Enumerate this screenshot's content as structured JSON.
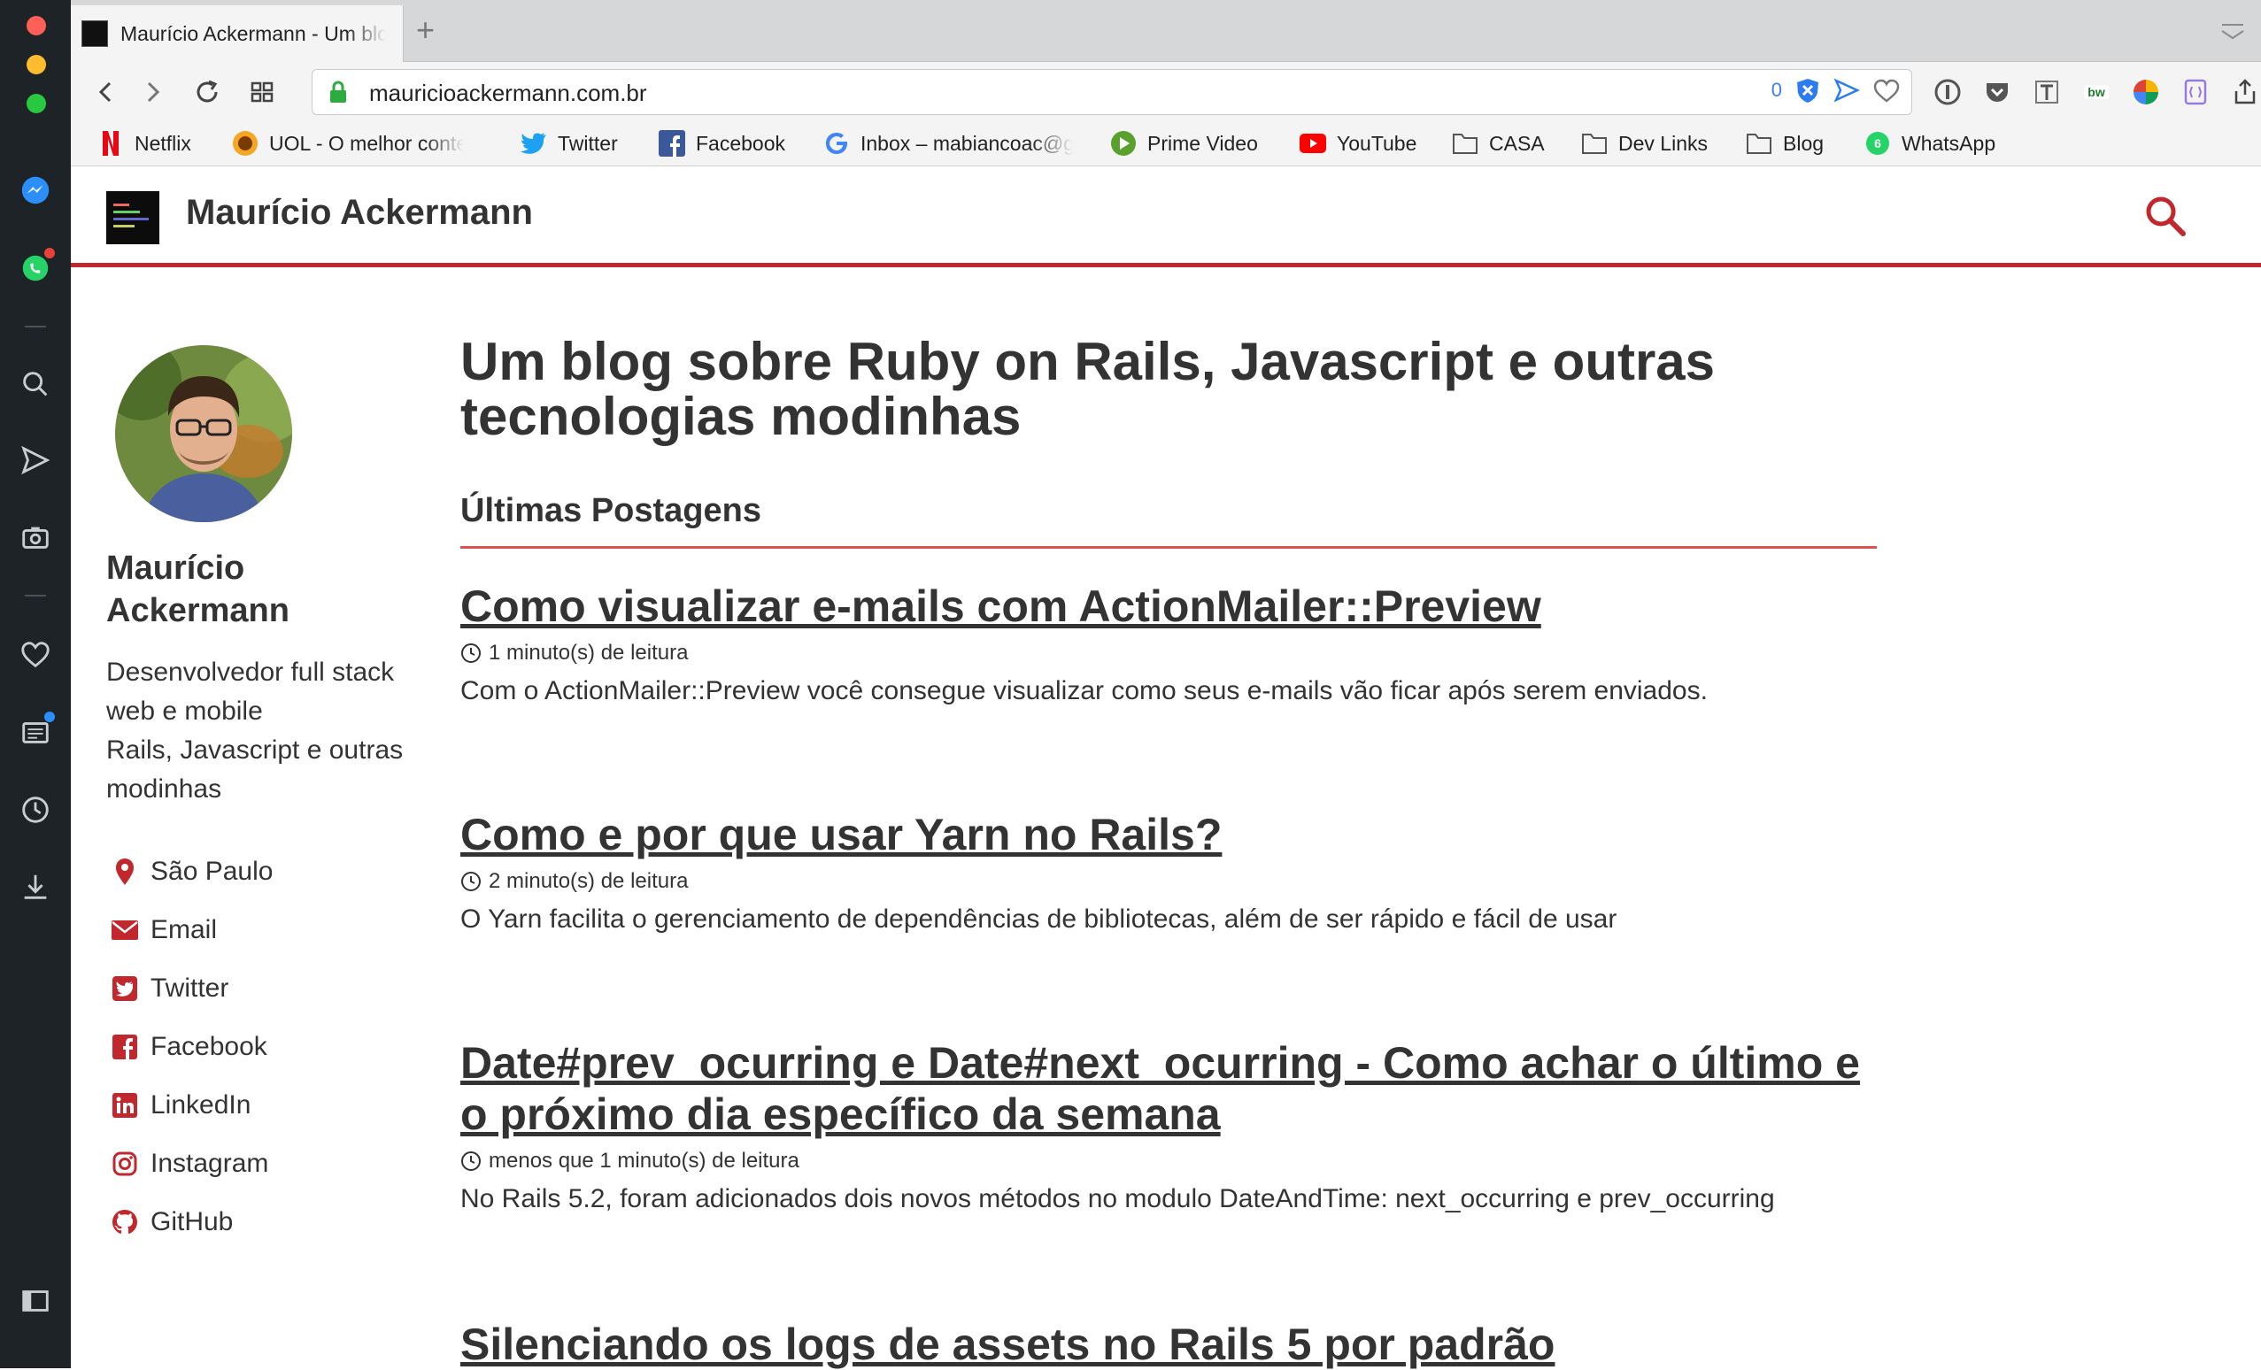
{
  "browser": {
    "tab_title": "Maurício Ackermann - Um blog sobre Ruby on Rails",
    "url": "mauricioackermann.com.br",
    "blocked_count": "0"
  },
  "bookmarks": [
    {
      "label": "Netflix",
      "icon": "netflix-icon"
    },
    {
      "label": "UOL - O melhor conteúdo",
      "icon": "uol-icon"
    },
    {
      "label": "Twitter",
      "icon": "twitter-icon"
    },
    {
      "label": "Facebook",
      "icon": "facebook-icon"
    },
    {
      "label": "Inbox – mabiancoac@gmail.com",
      "icon": "google-icon"
    },
    {
      "label": "Prime Video",
      "icon": "prime-video-icon"
    },
    {
      "label": "YouTube",
      "icon": "youtube-icon"
    },
    {
      "label": "CASA",
      "icon": "folder-icon"
    },
    {
      "label": "Dev Links",
      "icon": "folder-icon"
    },
    {
      "label": "Blog",
      "icon": "folder-icon"
    },
    {
      "label": "WhatsApp",
      "icon": "whatsapp-icon"
    }
  ],
  "site": {
    "title": "Maurício Ackermann"
  },
  "author": {
    "name": "Maurício Ackermann",
    "bio": "Desenvolvedor full stack web e mobile\nRails, Javascript e outras modinhas",
    "links": [
      {
        "label": "São Paulo",
        "icon": "location-icon"
      },
      {
        "label": "Email",
        "icon": "email-icon"
      },
      {
        "label": "Twitter",
        "icon": "twitter-icon"
      },
      {
        "label": "Facebook",
        "icon": "facebook-icon"
      },
      {
        "label": "LinkedIn",
        "icon": "linkedin-icon"
      },
      {
        "label": "Instagram",
        "icon": "instagram-icon"
      },
      {
        "label": "GitHub",
        "icon": "github-icon"
      }
    ]
  },
  "main": {
    "headline": "Um blog sobre Ruby on Rails, Javascript e outras tecnologias modinhas",
    "recent_heading": "Últimas Postagens",
    "posts": [
      {
        "title": "Como visualizar e-mails com ActionMailer::Preview",
        "meta": "1 minuto(s) de leitura",
        "excerpt": "Com o ActionMailer::Preview você consegue visualizar como seus e-mails vão ficar após serem enviados."
      },
      {
        "title": "Como e por que usar Yarn no Rails?",
        "meta": "2 minuto(s) de leitura",
        "excerpt": "O Yarn facilita o gerenciamento de dependências de bibliotecas, além de ser rápido e fácil de usar"
      },
      {
        "title": "Date#prev_ocurring e Date#next_ocurring - Como achar o último e o próximo dia específico da semana",
        "meta": "menos que 1 minuto(s) de leitura",
        "excerpt": "No Rails 5.2, foram adicionados dois novos métodos no modulo DateAndTime: next_occurring e prev_occurring"
      },
      {
        "title": "Silenciando os logs de assets no Rails 5 por padrão",
        "meta": "",
        "excerpt": ""
      }
    ]
  },
  "colors": {
    "accent": "#c0282d",
    "sidebar": "#1d2327",
    "text": "#333333"
  }
}
